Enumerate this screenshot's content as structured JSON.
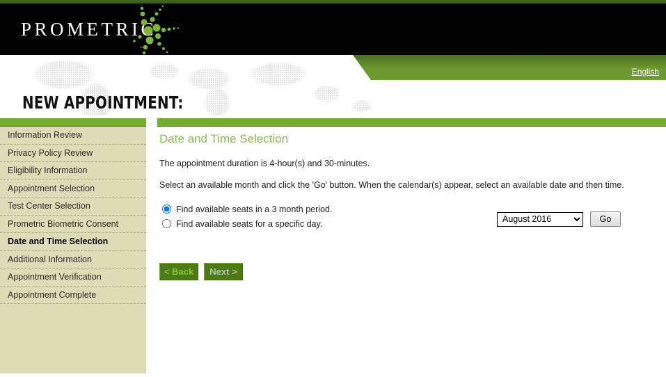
{
  "brand": {
    "wordmark": "PROMETRIC",
    "trademark": "™",
    "logo_icon": "prometric-starburst-icon"
  },
  "header": {
    "language_link": "English",
    "page_title": "NEW APPOINTMENT:"
  },
  "sidebar": {
    "items": [
      {
        "label": "Information Review",
        "current": false
      },
      {
        "label": "Privacy Policy Review",
        "current": false
      },
      {
        "label": "Eligibility Information",
        "current": false
      },
      {
        "label": "Appointment Selection",
        "current": false
      },
      {
        "label": "Test Center Selection",
        "current": false
      },
      {
        "label": "Prometric Biometric Consent",
        "current": false
      },
      {
        "label": "Date and Time Selection",
        "current": true
      },
      {
        "label": "Additional Information",
        "current": false
      },
      {
        "label": "Appointment Verification",
        "current": false
      },
      {
        "label": "Appointment Complete",
        "current": false
      }
    ]
  },
  "main": {
    "heading": "Date and Time Selection",
    "duration_text": "The appointment duration is 4-hour(s) and 30-minutes.",
    "instruction_text": "Select an available month and click the 'Go' button. When the calendar(s) appear, select an available date and then time.",
    "options": [
      {
        "label": "Find available seats in a 3 month period.",
        "selected": true
      },
      {
        "label": "Find available seats for a specific day.",
        "selected": false
      }
    ],
    "month_select": {
      "value": "August 2016",
      "options": [
        "August 2016"
      ]
    },
    "go_label": "Go",
    "back_label": "< Back",
    "next_label": "Next >"
  },
  "colors": {
    "accent_green": "#76ac2b",
    "banner_green": "#6c9a30",
    "dark_green_rule": "#3f6021",
    "sidebar_beige": "#dedcb6",
    "heading_green": "#8fbc5a",
    "button_green": "#4c7a15"
  }
}
